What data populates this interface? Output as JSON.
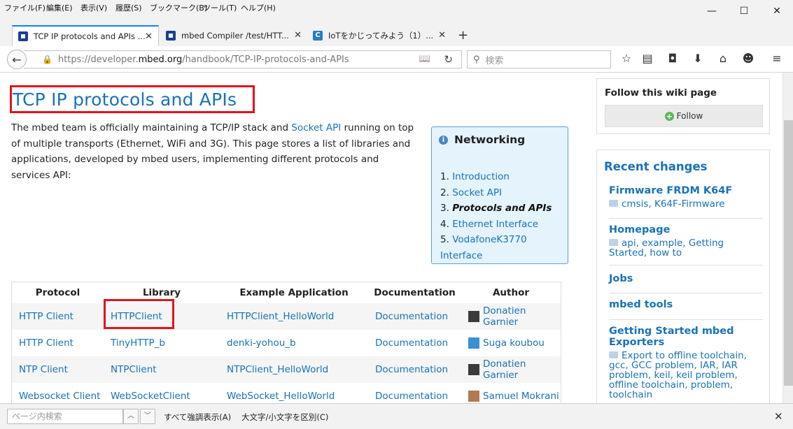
{
  "menubar": {
    "items": [
      "ファイル(F)",
      "編集(E)",
      "表示(V)",
      "履歴(S)",
      "ブックマーク(B)",
      "ツール(T)",
      "ヘルプ(H)"
    ]
  },
  "window_controls": {
    "minimize": "—",
    "maximize": "☐",
    "close": "✕"
  },
  "tabs": [
    {
      "title": "TCP IP protocols and APIs ...",
      "active": true
    },
    {
      "title": "mbed Compiler /test/HTT...",
      "active": false
    },
    {
      "title": "IoTをかじってみよう（1）...",
      "active": false
    }
  ],
  "newtab_label": "+",
  "navbar": {
    "url_prefix": "https://developer.",
    "url_domain": "mbed.org",
    "url_path": "/handbook/TCP-IP-protocols-and-APIs",
    "search_placeholder": "検索"
  },
  "page": {
    "title": "TCP IP protocols and APIs",
    "intro_before_link": "The mbed team is officially maintaining a TCP/IP stack and ",
    "intro_link": "Socket API",
    "intro_after_link": " running on top of multiple transports (Ethernet, WiFi and 3G). This page stores a list of libraries and applications, developed by mbed users, implementing different protocols and services API:"
  },
  "networking": {
    "title": "Networking",
    "items": [
      {
        "num": "1.",
        "label": "Introduction",
        "current": false
      },
      {
        "num": "2.",
        "label": "Socket API",
        "current": false
      },
      {
        "num": "3.",
        "label": "Protocols and APIs",
        "current": true
      },
      {
        "num": "4.",
        "label": "Ethernet Interface",
        "current": false
      },
      {
        "num": "5.",
        "label": "VodafoneK3770 Interface",
        "current": false
      }
    ]
  },
  "table": {
    "headers": [
      "Protocol",
      "Library",
      "Example Application",
      "Documentation",
      "Author"
    ],
    "rows": [
      {
        "protocol": "HTTP Client",
        "library": "HTTPClient",
        "example": "HTTPClient_HelloWorld",
        "doc": "Documentation",
        "author": "Donatien Garnier",
        "avatar_color": "#3b3b3b"
      },
      {
        "protocol": "HTTP Client",
        "library": "TinyHTTP_b",
        "example": "denki-yohou_b",
        "doc": "Documentation",
        "author": "Suga koubou",
        "avatar_color": "#3a8fd0"
      },
      {
        "protocol": "NTP Client",
        "library": "NTPClient",
        "example": "NTPClient_HelloWorld",
        "doc": "Documentation",
        "author": "Donatien Garnier",
        "avatar_color": "#3b3b3b"
      },
      {
        "protocol": "Websocket Client",
        "library": "WebSocketClient",
        "example": "WebSocket_HelloWorld",
        "doc": "Documentation",
        "author": "Samuel Mokrani",
        "avatar_color": "#b07a52"
      }
    ]
  },
  "sidebar": {
    "follow_label": "Follow this wiki page",
    "follow_button": "Follow",
    "recent_title": "Recent changes",
    "recent": [
      {
        "name": "Firmware FRDM K64F",
        "tags": "cmsis, K64F-Firmware"
      },
      {
        "name": "Homepage",
        "tags": "api, example, Getting Started, how to"
      },
      {
        "name": "Jobs",
        "tags": ""
      },
      {
        "name": "mbed tools",
        "tags": ""
      },
      {
        "name": "Getting Started mbed Exporters",
        "tags": "Export to offline toolchain, gcc, GCC problem, IAR, IAR problem, keil, keil problem, offline toolchain, problem, toolchain"
      }
    ]
  },
  "findbar": {
    "placeholder": "ページ内検索",
    "up": "︿",
    "down": "﹀",
    "highlight_all": "すべて強調表示(A)",
    "match_case": "大文字/小文字を区別(C)",
    "close": "✕"
  },
  "colors": {
    "link": "#1872b8",
    "annotation": "#e0141e",
    "networking_bg": "#e4f3fc"
  }
}
